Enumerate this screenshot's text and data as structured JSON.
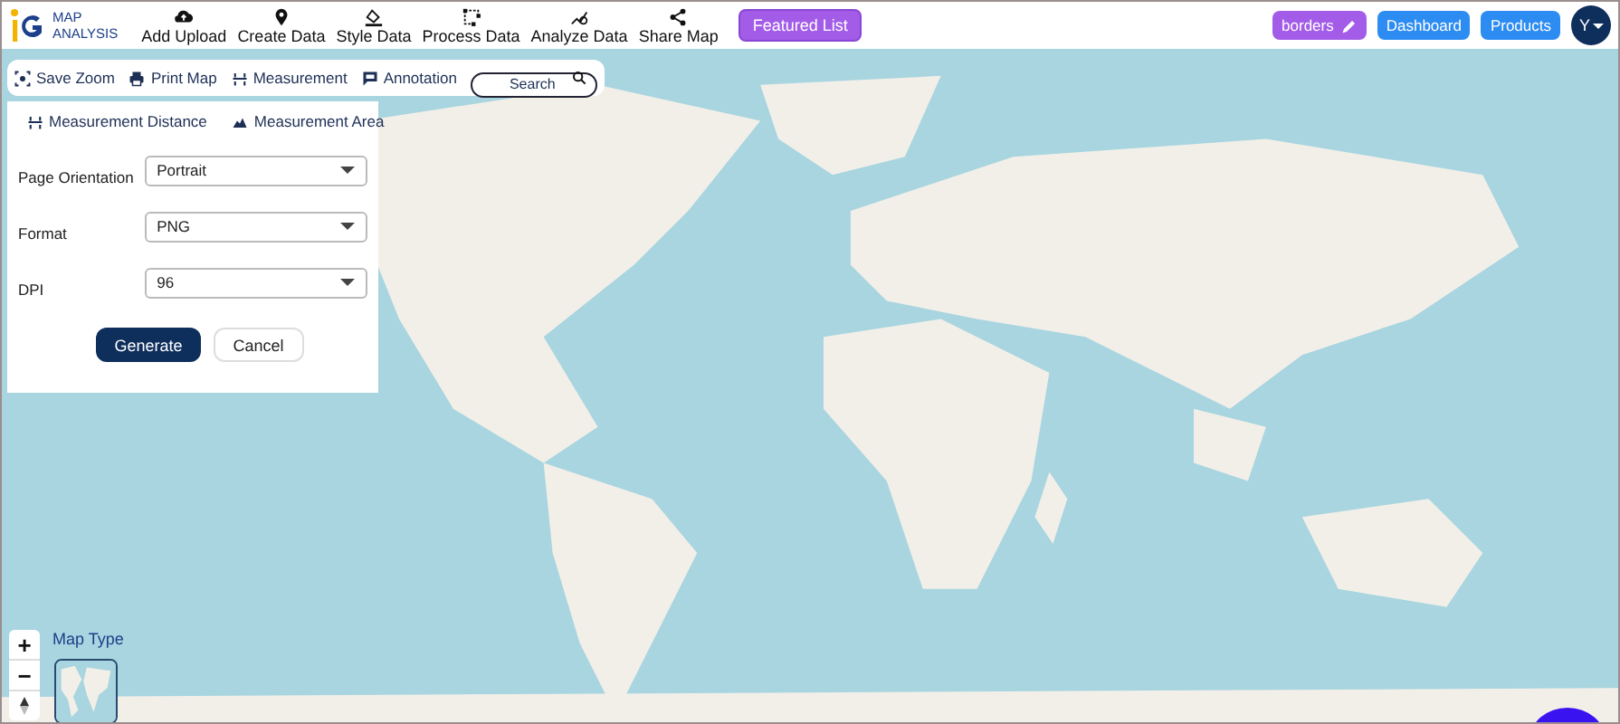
{
  "logo": {
    "line1": "MAP",
    "line2": "ANALYSIS"
  },
  "menu": [
    {
      "label": "Add Upload"
    },
    {
      "label": "Create Data"
    },
    {
      "label": "Style Data"
    },
    {
      "label": "Process Data"
    },
    {
      "label": "Analyze Data"
    },
    {
      "label": "Share Map"
    }
  ],
  "featured": "Featured List",
  "map_name": "borders",
  "buttons": [
    "Dashboard",
    "Products"
  ],
  "avatar": "Y",
  "toolbar": [
    {
      "label": "Save Zoom"
    },
    {
      "label": "Print Map"
    },
    {
      "label": "Measurement"
    },
    {
      "label": "Annotation"
    }
  ],
  "search": {
    "placeholder": "Search"
  },
  "measure_tabs": [
    {
      "label": "Measurement Distance"
    },
    {
      "label": "Measurement Area"
    }
  ],
  "fields": [
    {
      "label": "Page Orientation",
      "value": "Portrait"
    },
    {
      "label": "Format",
      "value": "PNG"
    },
    {
      "label": "DPI",
      "value": "96"
    }
  ],
  "actions": {
    "primary": "Generate",
    "secondary": "Cancel"
  },
  "zoom_controls": [
    "+",
    "−"
  ],
  "map_type": "Map Type"
}
